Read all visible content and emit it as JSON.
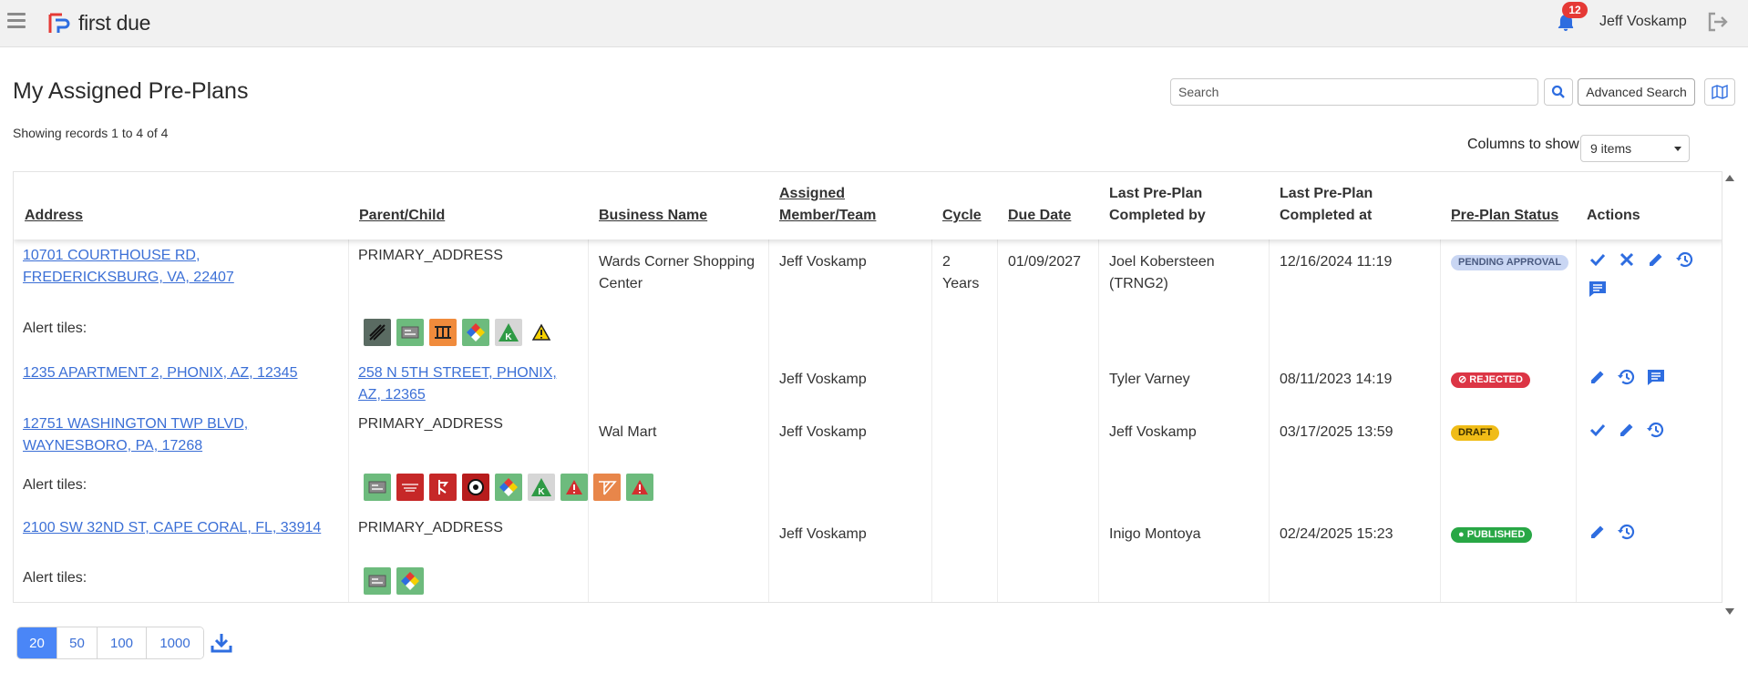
{
  "app": {
    "logo_text": "first due",
    "notification_count": "12",
    "user_name": "Jeff Voskamp"
  },
  "page": {
    "title": "My Assigned Pre-Plans",
    "records_text": "Showing records 1 to 4 of 4"
  },
  "search": {
    "placeholder": "Search",
    "advanced_label": "Advanced Search"
  },
  "columns_control": {
    "label": "Columns to show",
    "selected": "9 items"
  },
  "table": {
    "headers": {
      "address": "Address",
      "parent_child": "Parent/Child",
      "business_name": "Business Name",
      "assigned_1": "Assigned",
      "assigned_2": "Member/Team",
      "cycle": "Cycle",
      "due_date": "Due Date",
      "last_by_1": "Last Pre-Plan",
      "last_by_2": "Completed by",
      "last_at_1": "Last Pre-Plan",
      "last_at_2": "Completed at",
      "status": "Pre-Plan Status",
      "actions": "Actions"
    },
    "alert_label": "Alert tiles:",
    "rows": [
      {
        "address": "10701 COURTHOUSE RD, FREDERICKSBURG, VA, 22407",
        "parent_child": "PRIMARY_ADDRESS",
        "business_name": "Wards Corner Shopping Center",
        "assigned": "Jeff Voskamp",
        "cycle": "2 Years",
        "due_date": "01/09/2027",
        "last_by": "Joel Kobersteen (TRNG2)",
        "last_at": "12/16/2024 11:19",
        "status": "PENDING APPROVAL",
        "actions": [
          "approve-icon",
          "reject-icon",
          "edit-icon",
          "history-icon",
          "comment-icon"
        ],
        "alert_tiles": [
          "sprinkler-tile",
          "panel-tile",
          "fence-tile",
          "hazmat-diamond-tile",
          "knox-box-tile",
          "warning-triangle-tile"
        ]
      },
      {
        "address": "1235 APARTMENT 2, PHONIX, AZ, 12345",
        "parent_child": "258 N 5TH STREET, PHONIX, AZ, 12365",
        "business_name": "",
        "assigned": "Jeff Voskamp",
        "cycle": "",
        "due_date": "",
        "last_by": "Tyler Varney",
        "last_at": "08/11/2023 14:19",
        "status": "REJECTED",
        "actions": [
          "edit-icon",
          "history-icon",
          "comment-icon"
        ],
        "alert_tiles": []
      },
      {
        "address": "12751 WASHINGTON TWP BLVD, WAYNESBORO, PA, 17268",
        "parent_child": "PRIMARY_ADDRESS",
        "business_name": "Wal Mart",
        "assigned": "Jeff Voskamp",
        "cycle": "",
        "due_date": "",
        "last_by": "Jeff Voskamp",
        "last_at": "03/17/2025 13:59",
        "status": "DRAFT",
        "actions": [
          "approve-icon",
          "edit-icon",
          "history-icon"
        ],
        "alert_tiles": [
          "panel-tile",
          "fire-alarm-panel-tile",
          "standpipe-tile",
          "shutoff-valve-tile",
          "hazmat-diamond-tile",
          "knox-box-tile",
          "alert-tile",
          "roof-tile",
          "alert-tile"
        ]
      },
      {
        "address": "2100 SW 32ND ST, CAPE CORAL, FL, 33914",
        "parent_child": "PRIMARY_ADDRESS",
        "business_name": "",
        "assigned": "Jeff Voskamp",
        "cycle": "",
        "due_date": "",
        "last_by": "Inigo Montoya",
        "last_at": "02/24/2025 15:23",
        "status": "PUBLISHED",
        "actions": [
          "edit-icon",
          "history-icon"
        ],
        "alert_tiles": [
          "panel-tile",
          "hazmat-diamond-tile"
        ]
      }
    ]
  },
  "pagination": {
    "sizes": [
      "20",
      "50",
      "100",
      "1000"
    ],
    "active": "20"
  },
  "colors": {
    "accent": "#3b6fd6",
    "pending": "#c9d6f3",
    "rejected": "#dc3545",
    "draft": "#f0bc17",
    "published": "#28a745"
  }
}
